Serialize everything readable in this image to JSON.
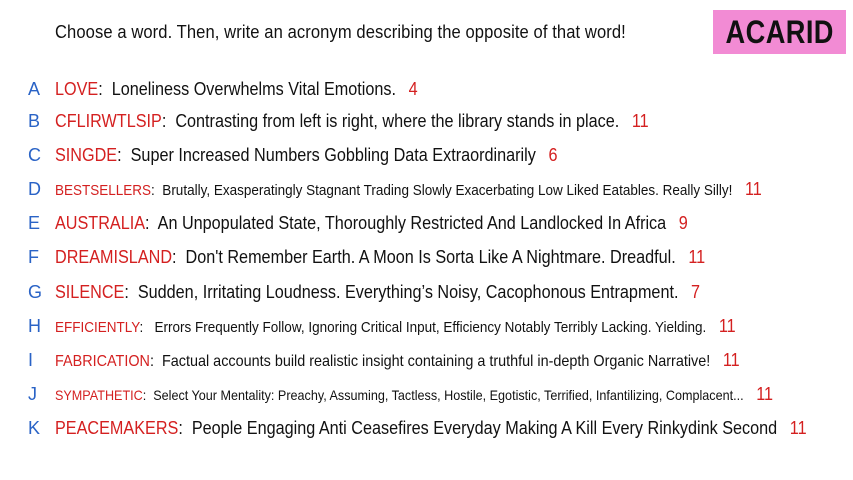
{
  "prompt": "Choose a word. Then, write an acronym describing the opposite of that word!",
  "logo_text": "ACARID",
  "colors": {
    "letter": "#2a63c6",
    "word": "#d42020",
    "score": "#d42020",
    "logo_bg": "#f28bd4"
  },
  "entries": [
    {
      "letter": "A",
      "word": "LOVE",
      "definition": "Loneliness Overwhelms Vital Emotions.",
      "score": "4"
    },
    {
      "letter": "B",
      "word": "CFLIRWTLSIP",
      "definition": "Contrasting from left is right, where the library stands in place.",
      "score": "11"
    },
    {
      "letter": "C",
      "word": "SINGDE",
      "definition": "Super Increased Numbers Gobbling Data Extraordinarily",
      "score": "6"
    },
    {
      "letter": "D",
      "word": "BESTSELLERS",
      "definition": "Brutally, Exasperatingly Stagnant Trading Slowly Exacerbating Low Liked Eatables. Really Silly!",
      "score": "11"
    },
    {
      "letter": "E",
      "word": "AUSTRALIA",
      "definition": "An Unpopulated State, Thoroughly Restricted And Landlocked In Africa",
      "score": "9"
    },
    {
      "letter": "F",
      "word": "DREAMISLAND",
      "definition": "Don't Remember Earth. A Moon Is Sorta Like A Nightmare. Dreadful.",
      "score": "11"
    },
    {
      "letter": "G",
      "word": "SILENCE",
      "definition": "Sudden, Irritating Loudness. Everything’s Noisy, Cacophonous Entrapment.",
      "score": "7"
    },
    {
      "letter": "H",
      "word": "EFFICIENTLY",
      "definition": "Errors Frequently Follow, Ignoring Critical Input, Efficiency Notably Terribly Lacking. Yielding.",
      "score": "11"
    },
    {
      "letter": "I",
      "word": "FABRICATION",
      "definition": "Factual accounts build realistic insight containing a truthful in-depth Organic Narrative!",
      "score": "11"
    },
    {
      "letter": "J",
      "word": "SYMPATHETIC",
      "definition": "Select Your Mentality: Preachy, Assuming, Tactless, Hostile, Egotistic, Terrified, Infantilizing, Complacent...",
      "score": "11"
    },
    {
      "letter": "K",
      "word": "PEACEMAKERS",
      "definition": "People Engaging Anti Ceasefires Everyday Making A Kill Every Rinkydink Second",
      "score": "11"
    }
  ]
}
